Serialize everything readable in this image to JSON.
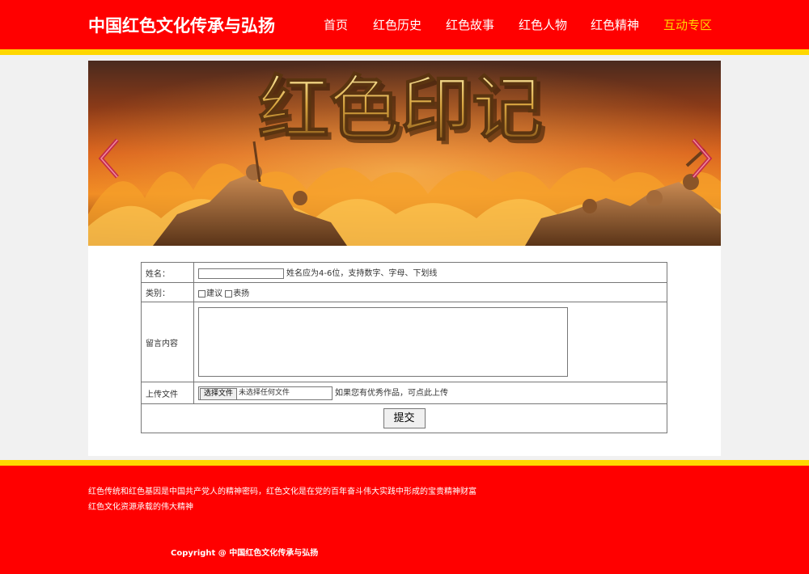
{
  "header": {
    "site_title": "中国红色文化传承与弘扬",
    "nav": [
      {
        "label": "首页"
      },
      {
        "label": "红色历史"
      },
      {
        "label": "红色故事"
      },
      {
        "label": "红色人物"
      },
      {
        "label": "红色精神"
      },
      {
        "label": "互动专区"
      }
    ],
    "active_nav": "互动专区"
  },
  "banner": {
    "title": "红色印记"
  },
  "form": {
    "name_label": "姓名：",
    "name_value": "",
    "name_hint": "姓名应为4-6位，支持数字、字母、下划线",
    "category_label": "类别：",
    "category_options": [
      {
        "label": "建议",
        "checked": false
      },
      {
        "label": "表扬",
        "checked": false
      }
    ],
    "message_label": "留言内容",
    "message_value": "",
    "upload_label": "上传文件",
    "file_button": "选择文件",
    "file_status": "未选择任何文件",
    "upload_hint": "如果您有优秀作品，可点此上传",
    "submit_label": "提交"
  },
  "footer": {
    "line1": "红色传统和红色基因是中国共产党人的精神密码，红色文化是在党的百年奋斗伟大实践中形成的宝贵精神财富",
    "line2": "红色文化资源承载的伟大精神",
    "copyright": "Copyright @ 中国红色文化传承与弘扬"
  },
  "colors": {
    "primary_red": "#ff0000",
    "accent_gold": "#ffd700",
    "active_nav": "#ffd700"
  }
}
